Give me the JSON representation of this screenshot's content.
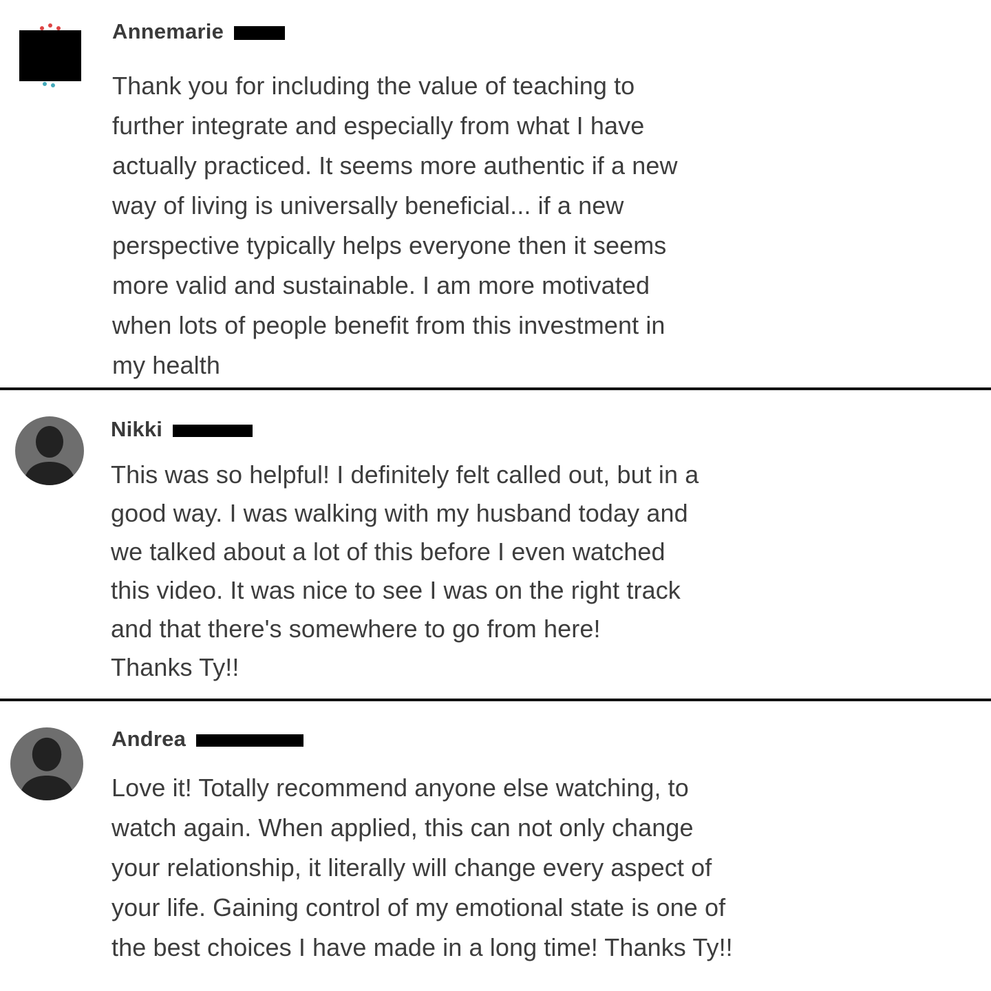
{
  "comments": [
    {
      "author": "Annemarie",
      "lines": [
        "Thank you for including the value of teaching to",
        "further integrate and especially from what I have",
        "actually practiced. It seems more authentic if a new",
        "way of living is universally beneficial... if a new",
        "perspective typically helps everyone then it seems",
        "more valid and sustainable. I am more motivated",
        "when lots of people benefit from this investment in",
        "my health"
      ]
    },
    {
      "author": "Nikki",
      "lines": [
        "This was so helpful! I definitely felt called out, but in a",
        "good way. I was walking with my husband today and",
        "we talked about a lot of this before I even watched",
        "this video. It was nice to see I was on the right track",
        "and that there's somewhere to go from here!",
        "Thanks Ty!!"
      ]
    },
    {
      "author": "Andrea",
      "lines": [
        "Love it! Totally recommend anyone else watching, to",
        "watch again. When applied, this can not only change",
        "your relationship, it literally will change every aspect of",
        "your life. Gaining control of my emotional state is one of",
        "the best choices I have made in a long time! Thanks Ty!!"
      ]
    }
  ],
  "colors": {
    "author_text": "#3a3a3a",
    "body_text": "#3d3d3d",
    "divider": "#111111",
    "avatar_bg": "#6e6e6e",
    "avatar_silhouette": "#222222",
    "redaction": "#000000"
  }
}
